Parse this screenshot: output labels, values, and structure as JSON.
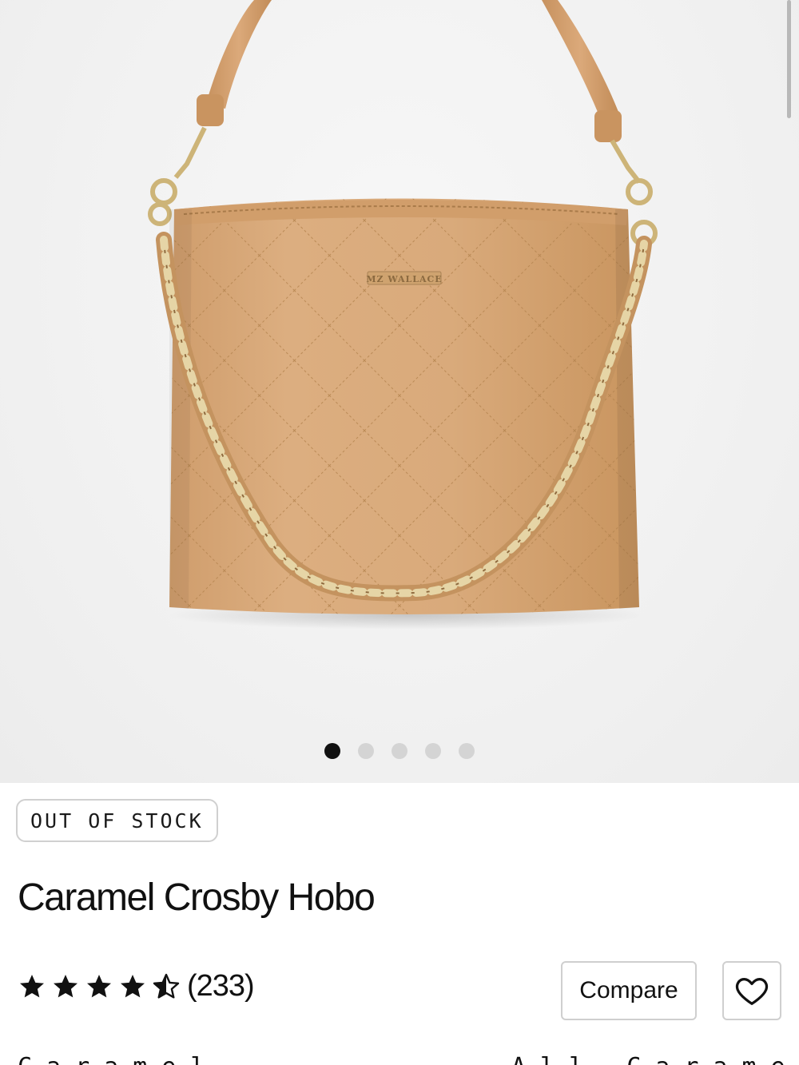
{
  "product": {
    "image": {
      "alt": "Caramel quilted hobo bag with leather strap and braided chain",
      "brand_mark": "MZ WALLACE",
      "icon": "product-photo",
      "colors": {
        "bag": "#d8a878",
        "bag_shadow": "#c48f5d",
        "stitch": "#b88858",
        "hardware": "#d9c58f"
      }
    },
    "carousel": {
      "count": 5,
      "active_index": 0
    },
    "stock_badge": "OUT OF STOCK",
    "title": "Caramel Crosby Hobo",
    "rating": {
      "stars": 4.5,
      "max": 5,
      "count_label": "(233)"
    },
    "compare_label": "Compare",
    "favorite_icon": "heart-outline-icon",
    "cut_off_row": {
      "left": "Caramel",
      "right": "All Caramel Styles"
    }
  }
}
